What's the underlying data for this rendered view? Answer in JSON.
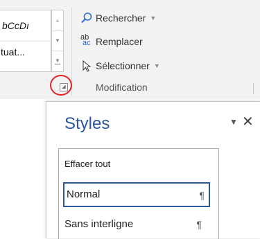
{
  "ribbon": {
    "gallery": {
      "top_sample": "bCcDı",
      "bottom_sample": "tuat..."
    },
    "modification": {
      "find_label": "Rechercher",
      "replace_label": "Remplacer",
      "select_label": "Sélectionner",
      "group_label": "Modification",
      "replace_icon_top": "ab",
      "replace_icon_bottom": "ac"
    }
  },
  "styles_pane": {
    "title": "Styles",
    "items": [
      {
        "label": "Effacer tout"
      },
      {
        "label": "Normal",
        "mark": "¶"
      },
      {
        "label": "Sans interligne",
        "mark": "¶"
      }
    ]
  },
  "icons": [
    "search-icon",
    "replace-icon",
    "select-cursor-icon",
    "dialog-launcher-icon",
    "pane-menu-icon",
    "close-icon"
  ],
  "colors": {
    "accent": "#2b579a",
    "highlight": "#e0242b"
  }
}
